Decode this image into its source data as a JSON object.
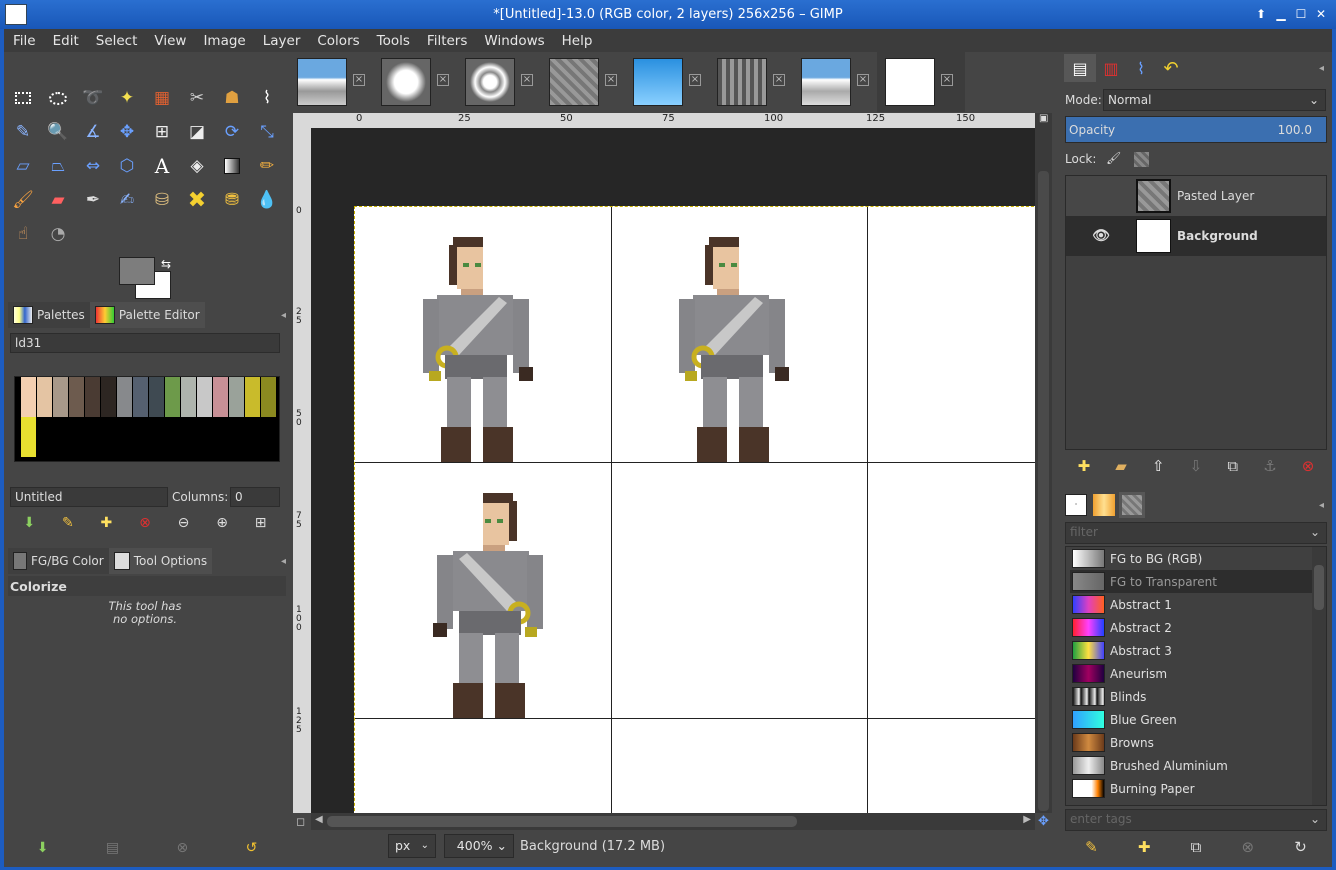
{
  "window": {
    "title": "*[Untitled]-13.0 (RGB color, 2 layers) 256x256 – GIMP"
  },
  "menu": [
    "File",
    "Edit",
    "Select",
    "View",
    "Image",
    "Layer",
    "Colors",
    "Tools",
    "Filters",
    "Windows",
    "Help"
  ],
  "left_tabs": {
    "palettes": "Palettes",
    "palette_editor": "Palette Editor"
  },
  "palette": {
    "name": "ld31",
    "colors": [
      "#f3cfb1",
      "#e4c4a3",
      "#a8998a",
      "#6d5b4e",
      "#4a3b33",
      "#2d2622",
      "#87898c",
      "#556070",
      "#3f4a52",
      "#6d9a4a",
      "#aeb4ad",
      "#c8c8c8",
      "#c89096",
      "#9aa29a",
      "#c9bb2b",
      "#8b8a20",
      "#e8e030"
    ],
    "name_field": "Untitled",
    "columns_label": "Columns:",
    "columns_value": "0"
  },
  "lower_tabs": {
    "fgbg": "FG/BG Color",
    "tool_options": "Tool Options"
  },
  "tool_options": {
    "title": "Colorize",
    "message_l1": "This tool has",
    "message_l2": "no options."
  },
  "rulers": {
    "h": [
      "0",
      "25",
      "50",
      "75",
      "100",
      "125",
      "150"
    ],
    "v": [
      "0",
      "25",
      "50",
      "75",
      "100",
      "125"
    ]
  },
  "status": {
    "unit": "px",
    "zoom": "400%",
    "message": "Background (17.2 MB)"
  },
  "layers_panel": {
    "mode_label": "Mode:",
    "mode_value": "Normal",
    "opacity_label": "Opacity",
    "opacity_value": "100.0",
    "lock_label": "Lock:",
    "layers": [
      {
        "name": "Pasted Layer",
        "visible": false
      },
      {
        "name": "Background",
        "visible": true
      }
    ]
  },
  "gradients_panel": {
    "filter_placeholder": "filter",
    "tags_placeholder": "enter tags",
    "items": [
      {
        "name": "FG to BG (RGB)",
        "css": "linear-gradient(90deg,#fff,#777)"
      },
      {
        "name": "FG to Transparent",
        "css": "linear-gradient(90deg,#888,#666)"
      },
      {
        "name": "Abstract 1",
        "css": "linear-gradient(90deg,#3040ff,#e040c0,#ff6020)"
      },
      {
        "name": "Abstract 2",
        "css": "linear-gradient(90deg,#ff2030,#ff40ff,#2040ff)"
      },
      {
        "name": "Abstract 3",
        "css": "linear-gradient(90deg,#20a040,#ffe040,#4040ff)"
      },
      {
        "name": "Aneurism",
        "css": "linear-gradient(90deg,#200040,#a00060,#200040)"
      },
      {
        "name": "Blinds",
        "css": "repeating-linear-gradient(90deg,#111 0,#eee 6px,#111 8px)"
      },
      {
        "name": "Blue Green",
        "css": "linear-gradient(90deg,#30a0ff,#30ffe0)"
      },
      {
        "name": "Browns",
        "css": "linear-gradient(90deg,#6b3a1a,#d08a40,#6b3a1a)"
      },
      {
        "name": "Brushed Aluminium",
        "css": "linear-gradient(90deg,#999,#eee,#888)"
      },
      {
        "name": "Burning Paper",
        "css": "linear-gradient(90deg,#fff 60%,#ff8000,#000)"
      }
    ]
  },
  "colors": {
    "accent": "#1d5cc0",
    "opacity_bar": "#3b6fb0",
    "layer_selected": "#2d2d2d"
  }
}
